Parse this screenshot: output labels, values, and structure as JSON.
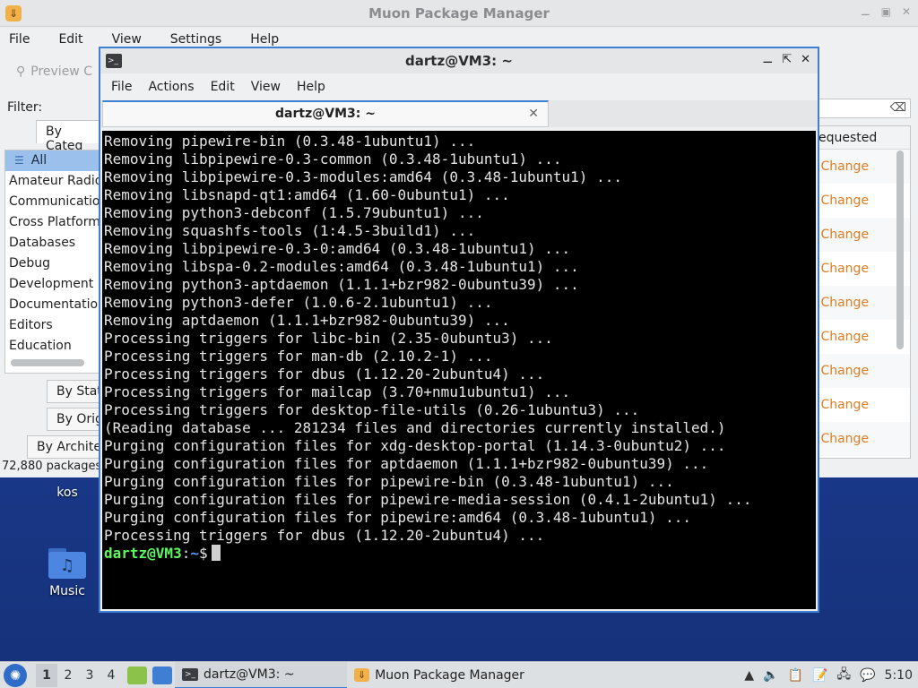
{
  "desktop": {
    "icons": [
      {
        "label": "kos"
      },
      {
        "label": "Music"
      }
    ]
  },
  "muon": {
    "title": "Muon Package Manager",
    "menu": [
      "File",
      "Edit",
      "View",
      "Settings",
      "Help"
    ],
    "preview_label": "Preview C",
    "filter_label": "Filter:",
    "tab_by_category": "By Categ",
    "categories": [
      "All",
      "Amateur Radio",
      "Communication",
      "Cross Platform",
      "Databases",
      "Debug",
      "Development",
      "Documentation",
      "Editors",
      "Education"
    ],
    "group_by_status": "By Stat",
    "group_by_origin": "By Orig",
    "group_by_arch": "By Archite",
    "package_count": "72,880 packages",
    "column_requested": "equested",
    "change_rows": [
      "Change",
      "Change",
      "Change",
      "Change",
      "Change",
      "Change",
      "Change",
      "Change",
      "Change"
    ]
  },
  "terminal": {
    "title": "dartz@VM3: ~",
    "menu": [
      "File",
      "Actions",
      "Edit",
      "View",
      "Help"
    ],
    "tab_label": "dartz@VM3: ~",
    "lines": [
      "Removing pipewire-bin (0.3.48-1ubuntu1) ...",
      "Removing libpipewire-0.3-common (0.3.48-1ubuntu1) ...",
      "Removing libpipewire-0.3-modules:amd64 (0.3.48-1ubuntu1) ...",
      "Removing libsnapd-qt1:amd64 (1.60-0ubuntu1) ...",
      "Removing python3-debconf (1.5.79ubuntu1) ...",
      "Removing squashfs-tools (1:4.5-3build1) ...",
      "Removing libpipewire-0.3-0:amd64 (0.3.48-1ubuntu1) ...",
      "Removing libspa-0.2-modules:amd64 (0.3.48-1ubuntu1) ...",
      "Removing python3-aptdaemon (1.1.1+bzr982-0ubuntu39) ...",
      "Removing python3-defer (1.0.6-2.1ubuntu1) ...",
      "Removing aptdaemon (1.1.1+bzr982-0ubuntu39) ...",
      "Processing triggers for libc-bin (2.35-0ubuntu3) ...",
      "Processing triggers for man-db (2.10.2-1) ...",
      "Processing triggers for dbus (1.12.20-2ubuntu4) ...",
      "Processing triggers for mailcap (3.70+nmu1ubuntu1) ...",
      "Processing triggers for desktop-file-utils (0.26-1ubuntu3) ...",
      "(Reading database ... 281234 files and directories currently installed.)",
      "Purging configuration files for xdg-desktop-portal (1.14.3-0ubuntu2) ...",
      "Purging configuration files for aptdaemon (1.1.1+bzr982-0ubuntu39) ...",
      "Purging configuration files for pipewire-bin (0.3.48-1ubuntu1) ...",
      "Purging configuration files for pipewire-media-session (0.4.1-2ubuntu1) ...",
      "Purging configuration files for pipewire:amd64 (0.3.48-1ubuntu1) ...",
      "Processing triggers for dbus (1.12.20-2ubuntu4) ..."
    ],
    "prompt_user": "dartz@VM3",
    "prompt_sep": ":",
    "prompt_path": "~",
    "prompt_symbol": "$"
  },
  "taskbar": {
    "workspaces": [
      "1",
      "2",
      "3",
      "4"
    ],
    "tasks": [
      {
        "label": "dartz@VM3: ~",
        "icon": "terminal-icon"
      },
      {
        "label": "Muon Package Manager",
        "icon": "muon-icon"
      }
    ],
    "clock": "5:10"
  }
}
